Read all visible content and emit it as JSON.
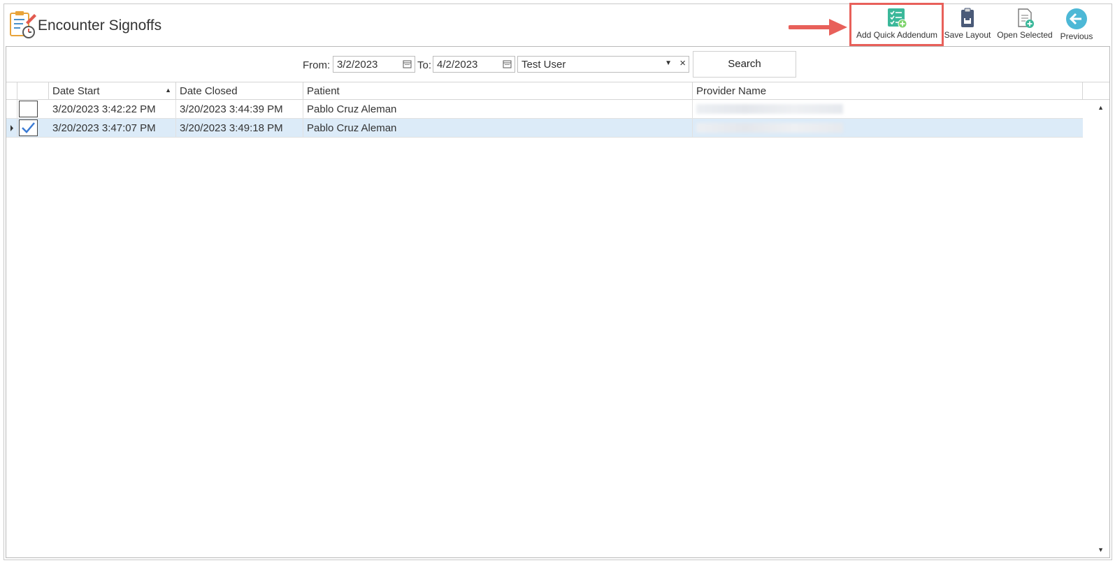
{
  "app": {
    "title": "Encounter Signoffs"
  },
  "toolbar": {
    "add_quick_addendum": "Add Quick Addendum",
    "save_layout": "Save Layout",
    "open_selected": "Open Selected",
    "previous": "Previous"
  },
  "filters": {
    "from_label": "From:",
    "from_value": "3/2/2023",
    "to_label": "To:",
    "to_value": "4/2/2023",
    "user_value": "Test User",
    "clear_symbol": "×",
    "search_label": "Search"
  },
  "grid": {
    "columns": [
      "Date Start",
      "Date Closed",
      "Patient",
      "Provider Name"
    ],
    "sort_indicator": "▲",
    "rows": [
      {
        "checked": false,
        "date_start": "3/20/2023 3:42:22 PM",
        "date_closed": "3/20/2023 3:44:39 PM",
        "patient": "Pablo Cruz Aleman"
      },
      {
        "checked": true,
        "date_start": "3/20/2023 3:47:07 PM",
        "date_closed": "3/20/2023 3:49:18 PM",
        "patient": "Pablo Cruz Aleman"
      }
    ]
  },
  "colors": {
    "highlight": "#e8605a",
    "selected_row": "#dcebf8",
    "accent_teal": "#3bb89a",
    "accent_circle": "#4db8d6"
  }
}
